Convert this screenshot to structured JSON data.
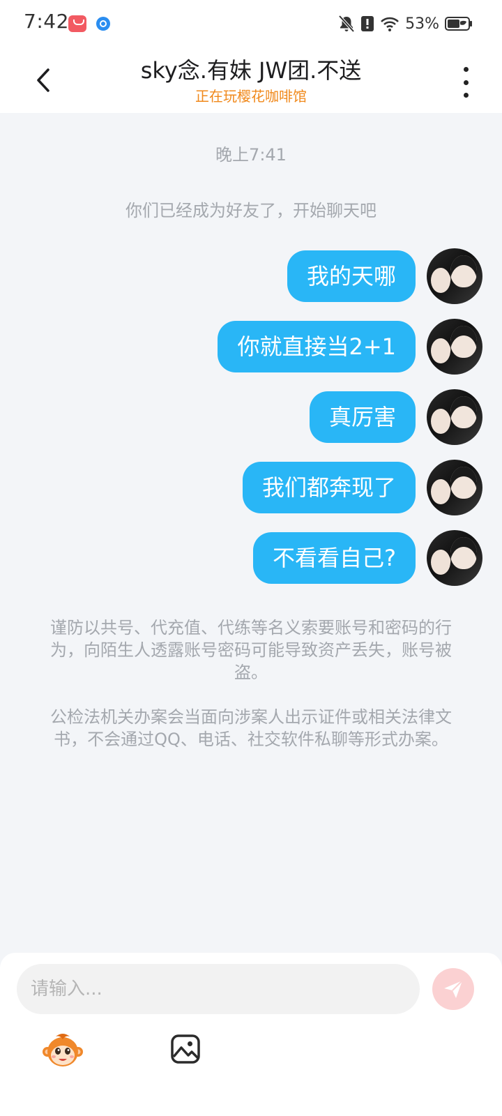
{
  "status_bar": {
    "time": "7:42",
    "battery": "53%",
    "icons": [
      "shopping-app-icon",
      "browser-app-icon",
      "bell-off-icon",
      "alert-icon",
      "wifi-icon",
      "battery-icon"
    ]
  },
  "header": {
    "title": "sky念.有妹 JW团.不送",
    "subtitle": "正在玩樱花咖啡馆",
    "subtitle_color": "#f0881a"
  },
  "chat": {
    "timestamp": "晚上7:41",
    "system_message": "你们已经成为好友了，开始聊天吧",
    "messages": [
      {
        "text": "我的天哪",
        "sender": "self"
      },
      {
        "text": "你就直接当2+1",
        "sender": "self"
      },
      {
        "text": "真厉害",
        "sender": "self"
      },
      {
        "text": "我们都奔现了",
        "sender": "self"
      },
      {
        "text": "不看看自己?",
        "sender": "self"
      }
    ],
    "bubble_color": "#29b6f6",
    "notice_1": "谨防以共号、代充值、代练等名义索要账号和密码的行为，向陌生人透露账号密码可能导致资产丢失，账号被盗。",
    "notice_2": "公检法机关办案会当面向涉案人出示证件或相关法律文书，不会通过QQ、电话、社交软件私聊等形式办案。"
  },
  "composer": {
    "placeholder": "请输入...",
    "send_button_color": "#fbd1d2"
  }
}
